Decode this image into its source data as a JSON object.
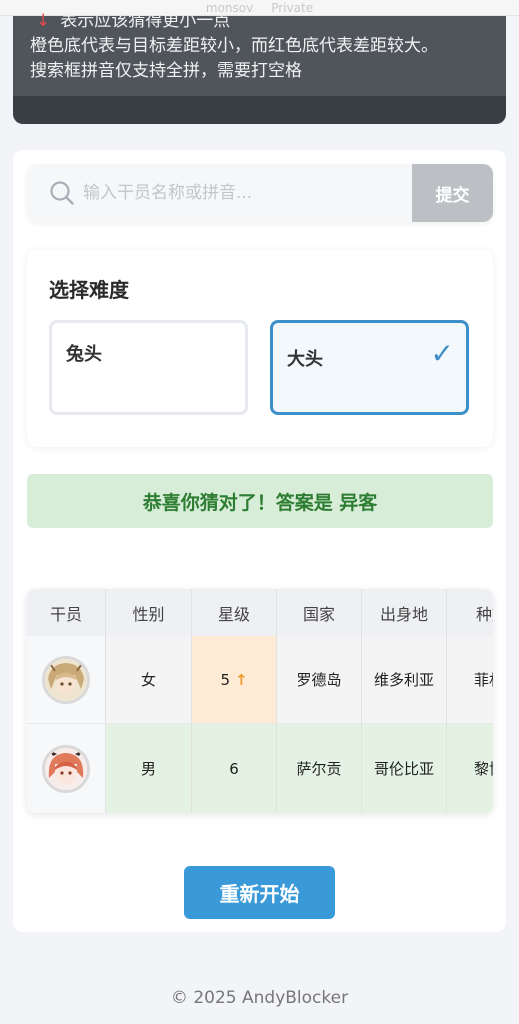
{
  "top_strip": {
    "left_text": "monsov",
    "right_text": "Private"
  },
  "notice": {
    "arrow": "↓",
    "line1": "表示应该猜得更小一点",
    "line2": "橙色底代表与目标差距较小，而红色底代表差距较大。",
    "line3": "搜索框拼音仅支持全拼，需要打空格"
  },
  "search": {
    "placeholder": "输入干员名称或拼音...",
    "value": "",
    "submit_label": "提交",
    "icon": "search-icon"
  },
  "difficulty": {
    "title": "选择难度",
    "options": [
      {
        "label": "兔头",
        "selected": false
      },
      {
        "label": "大头",
        "selected": true
      }
    ],
    "check_glyph": "✓"
  },
  "result": {
    "message": "恭喜你猜对了！答案是 异客"
  },
  "table": {
    "headers": [
      "干员",
      "性别",
      "星级",
      "国家",
      "出身地",
      "种族"
    ],
    "rows": [
      {
        "gender": "女",
        "stars": "5",
        "stars_hint": "↑",
        "country": "罗德岛",
        "origin": "维多利亚",
        "race": "菲林"
      },
      {
        "gender": "男",
        "stars": "6",
        "stars_hint": "",
        "country": "萨尔贡",
        "origin": "哥伦比亚",
        "race": "黎博利"
      }
    ]
  },
  "restart_label": "重新开始",
  "footer": "© 2025 AndyBlocker",
  "colors": {
    "accent_blue": "#3a99d8",
    "success_bg": "#d7edd8",
    "success_text": "#2d7d32",
    "close_bg": "#fdebd6",
    "correct_bg": "#e3f2e2",
    "hint_arrow": "#f09a2a"
  }
}
